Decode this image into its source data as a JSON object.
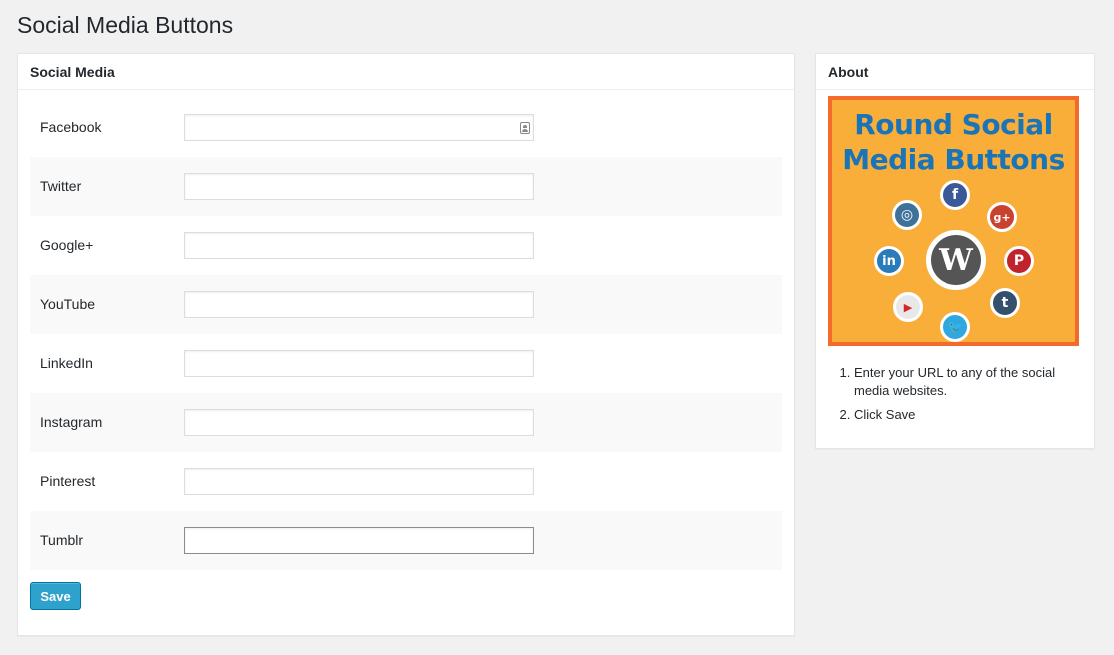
{
  "page": {
    "title": "Social Media Buttons"
  },
  "main_box": {
    "heading": "Social Media",
    "fields": [
      {
        "label": "Facebook",
        "value": ""
      },
      {
        "label": "Twitter",
        "value": ""
      },
      {
        "label": "Google+",
        "value": ""
      },
      {
        "label": "YouTube",
        "value": ""
      },
      {
        "label": "LinkedIn",
        "value": ""
      },
      {
        "label": "Instagram",
        "value": ""
      },
      {
        "label": "Pinterest",
        "value": ""
      },
      {
        "label": "Tumblr",
        "value": ""
      }
    ],
    "save_label": "Save"
  },
  "about_box": {
    "heading": "About",
    "promo": {
      "line1": "Round Social",
      "line2": "Media Buttons",
      "center_glyph": "W",
      "icons": {
        "facebook": {
          "glyph": "f",
          "color": "#3b5998"
        },
        "google_plus": {
          "glyph": "g+",
          "color": "#c9412f"
        },
        "pinterest": {
          "glyph": "P",
          "color": "#c0232b"
        },
        "tumblr": {
          "glyph": "t",
          "color": "#35506d"
        },
        "twitter": {
          "glyph": "🐦",
          "color": "#2fa8e0"
        },
        "youtube": {
          "glyph": "▶",
          "color": "#e0e0e0"
        },
        "linkedin": {
          "glyph": "in",
          "color": "#2b7bb9"
        },
        "instagram": {
          "glyph": "◎",
          "color": "#3f729b"
        }
      },
      "colors": {
        "background": "#f9ae3a",
        "border": "#f36a2a",
        "title": "#1a74b8"
      }
    },
    "instructions": [
      "Enter your URL to any of the social media websites.",
      "Click Save"
    ]
  },
  "colors": {
    "primary_button": "#2ea2cc",
    "page_bg": "#f1f1f1"
  }
}
